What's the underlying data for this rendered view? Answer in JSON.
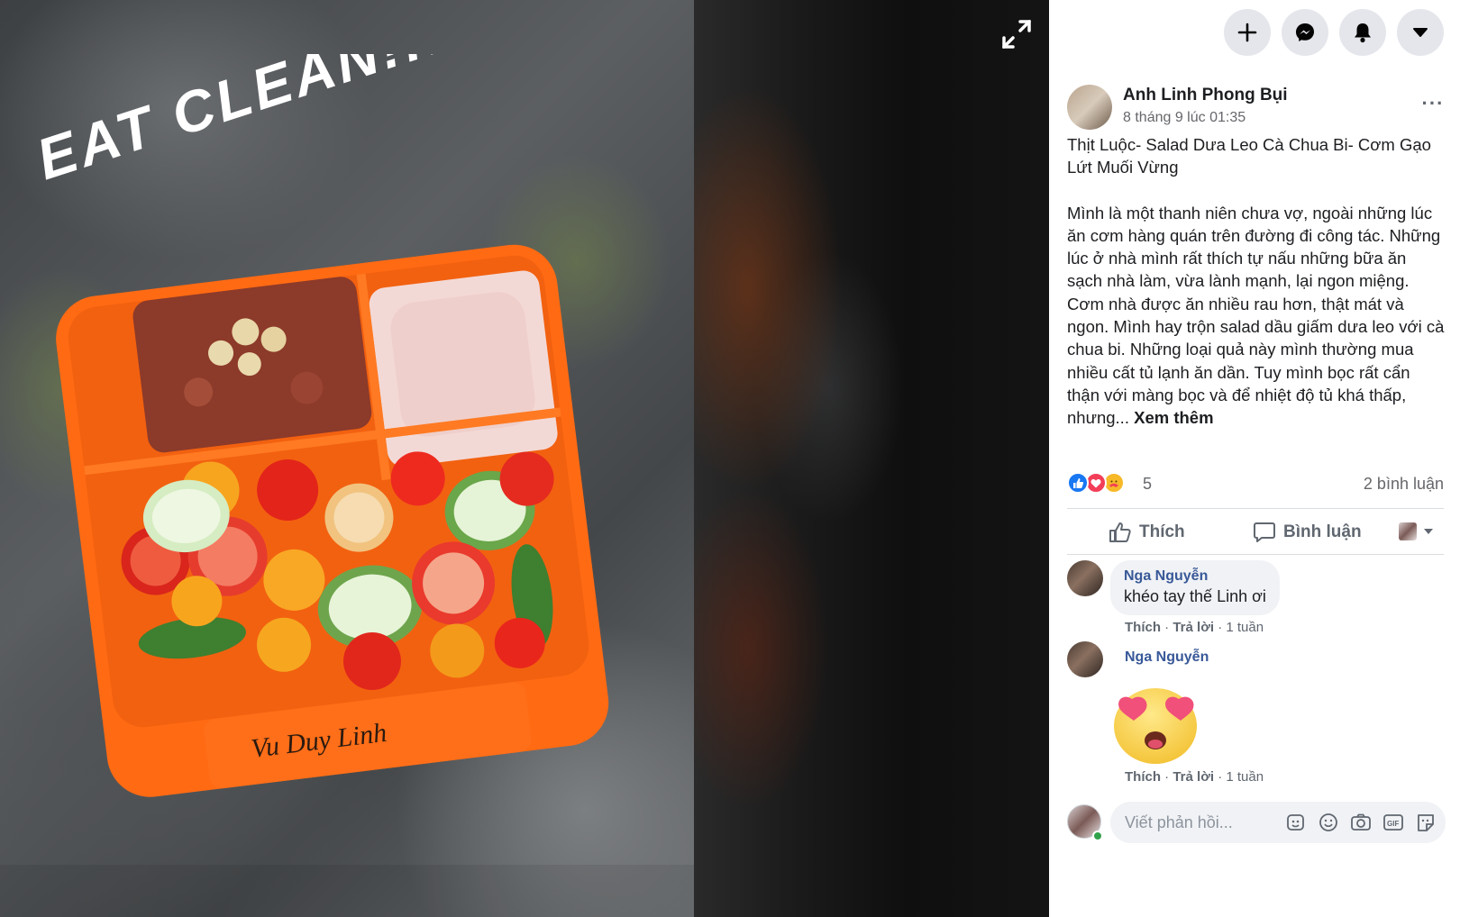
{
  "photo": {
    "overlay_text": "EAT CLEAN!!!",
    "signature": "Vu Duy Linh"
  },
  "post": {
    "author": "Anh Linh Phong Bụi",
    "time": "8 tháng 9 lúc 01:35",
    "title": "Thịt Luộc- Salad Dưa Leo Cà Chua Bi- Cơm Gạo Lứt Muối Vừng",
    "text": "Mình là một thanh niên chưa vợ, ngoài những lúc ăn cơm hàng quán trên đường đi công tác. Những lúc ở nhà mình rất thích tự nấu những bữa ăn sạch nhà làm, vừa lành mạnh, lại ngon miệng. Cơm nhà được ăn nhiều rau hơn, thật mát và ngon. Mình hay trộn salad dầu giấm dưa leo với cà chua bi. Những loại quả này mình thường mua nhiều cất tủ lạnh ăn dần. Tuy mình bọc rất cẩn thận với màng bọc và để nhiệt độ tủ khá thấp, nhưng... ",
    "see_more": "Xem thêm",
    "reaction_count": "5",
    "comment_count": "2 bình luận"
  },
  "actions": {
    "like": "Thích",
    "comment": "Bình luận"
  },
  "comments": [
    {
      "name": "Nga Nguyễn",
      "text": "khéo tay thế Linh ơi",
      "like": "Thích",
      "reply": "Trả lời",
      "age": "1 tuần"
    },
    {
      "name": "Nga Nguyễn",
      "sticker": "heart-eyes-emoji",
      "like": "Thích",
      "reply": "Trả lời",
      "age": "1 tuần"
    }
  ],
  "reply_box": {
    "placeholder": "Viết phản hồi..."
  },
  "colors": {
    "like_blue": "#1877f2",
    "love_red": "#f33e58",
    "link_blue": "#385898",
    "box_orange": "#ff6a13"
  }
}
